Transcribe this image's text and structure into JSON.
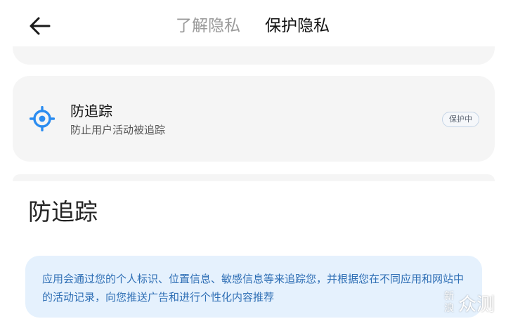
{
  "header": {
    "back_icon": "arrow-left-icon",
    "tabs": [
      {
        "label": "了解隐私",
        "active": false
      },
      {
        "label": "保护隐私",
        "active": true
      }
    ]
  },
  "feature_card": {
    "icon": "target-crosshair-icon",
    "title": "防追踪",
    "subtitle": "防止用户活动被追踪",
    "status_badge": "保护中"
  },
  "section": {
    "title": "防追踪",
    "description": "应用会通过您的个人标识、位置信息、敏感信息等来追踪您，并根据您在不同应用和网站中的活动记录，向您推送广告和进行个性化内容推荐"
  },
  "watermark": {
    "mark": "新浪",
    "text": "众测"
  },
  "colors": {
    "accent": "#2b8cf0",
    "card_bg": "#f5f5f5",
    "info_bg": "#e5f1fd",
    "info_text": "#2f6fb5"
  }
}
